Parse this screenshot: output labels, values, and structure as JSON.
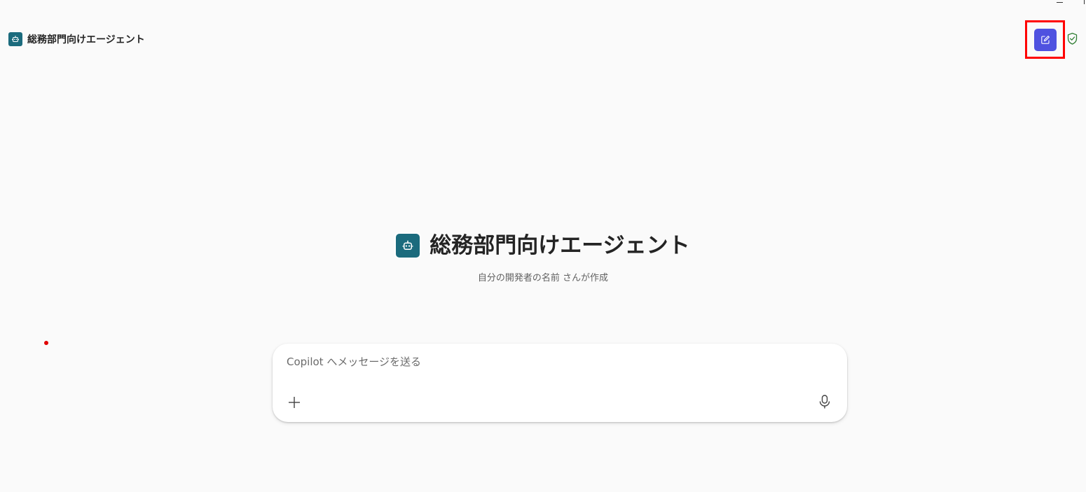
{
  "header": {
    "title": "総務部門向けエージェント",
    "agent_icon": "bot-icon"
  },
  "toolbar": {
    "new_chat_icon": "new-chat-icon",
    "shield_icon": "shield-check-icon"
  },
  "hero": {
    "title": "総務部門向けエージェント",
    "subtitle": "自分の開発者の名前 さんが作成"
  },
  "composer": {
    "placeholder": "Copilot へメッセージを送る",
    "value": "",
    "add_icon": "plus-icon",
    "mic_icon": "microphone-icon"
  },
  "colors": {
    "background": "#fafafa",
    "agent_icon_bg": "#1b6b7d",
    "accent": "#4f52e0",
    "highlight_border": "#ff0000",
    "shield": "#2e7d32"
  }
}
